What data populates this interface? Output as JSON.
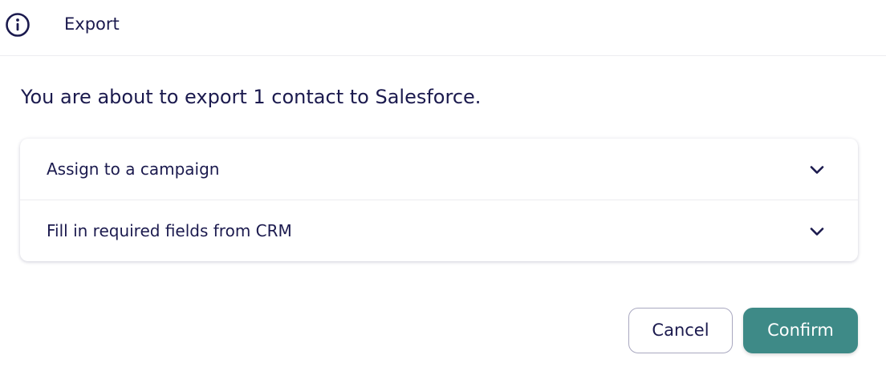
{
  "header": {
    "icon": "info-icon",
    "title": "Export"
  },
  "message": "You are about to export 1 contact to Salesforce.",
  "accordion": {
    "items": [
      {
        "label": "Assign to a campaign",
        "icon": "chevron-down-icon",
        "expanded": false
      },
      {
        "label": "Fill in required fields from CRM",
        "icon": "chevron-down-icon",
        "expanded": false
      }
    ]
  },
  "actions": {
    "cancel_label": "Cancel",
    "confirm_label": "Confirm"
  },
  "colors": {
    "text": "#1b1a4e",
    "accent": "#3e8a87",
    "border": "#a9a8c0",
    "divider": "#ececf0"
  }
}
